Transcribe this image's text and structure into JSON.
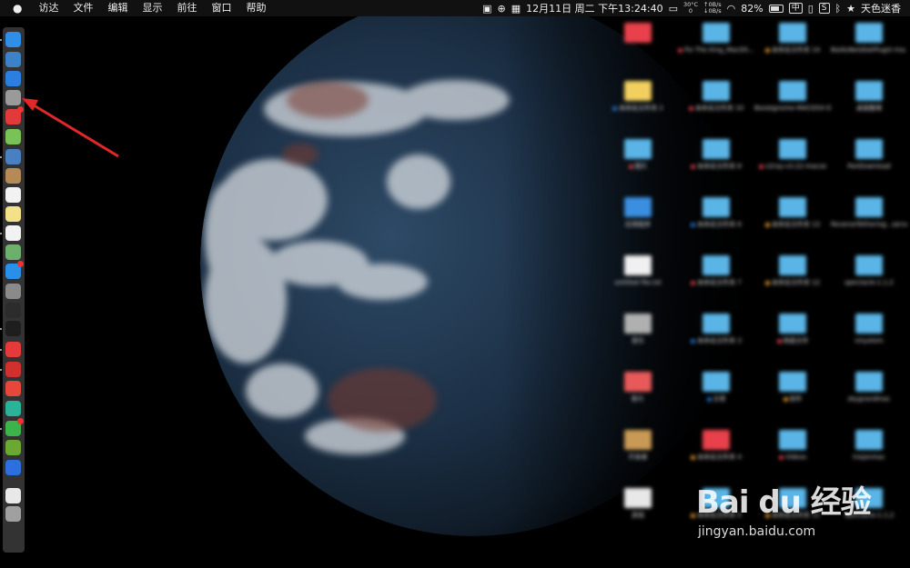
{
  "menubar": {
    "apple_icon": "apple-logo",
    "menus": [
      "访达",
      "文件",
      "编辑",
      "显示",
      "前往",
      "窗口",
      "帮助"
    ],
    "status": {
      "datetime": "12月11日 周二 下午13:24:40",
      "temperature": "30°C",
      "temp_extra": "0",
      "net_up": "0B/s",
      "net_down": "0B/s",
      "battery_percent": "82%",
      "input_method": "中",
      "user_name": "天色迷香",
      "icons": [
        "dropbox-icon",
        "globe-icon",
        "calendar-icon",
        "screen-icon",
        "wifi-icon",
        "battery-icon",
        "ime-icon",
        "s-app-icon",
        "bluetooth-icon",
        "star-icon"
      ]
    }
  },
  "dock": {
    "icons": [
      {
        "name": "finder-icon",
        "color": "#2f8fe8"
      },
      {
        "name": "launchpad-icon",
        "color": "#3b82c8"
      },
      {
        "name": "safari-icon",
        "color": "#2a7fe0"
      },
      {
        "name": "rocket-icon",
        "color": "#9a9a9a"
      },
      {
        "name": "red-app-icon",
        "color": "#e03a3a"
      },
      {
        "name": "android-icon",
        "color": "#78c257"
      },
      {
        "name": "preview-icon",
        "color": "#4a7fc2"
      },
      {
        "name": "notes-brown-icon",
        "color": "#b58a55"
      },
      {
        "name": "calendar-icon",
        "color": "#f2f2f2"
      },
      {
        "name": "notes-icon",
        "color": "#f5e08a"
      },
      {
        "name": "reminders-icon",
        "color": "#f2f2f2"
      },
      {
        "name": "maps-icon",
        "color": "#6bb16b"
      },
      {
        "name": "app-store-icon",
        "color": "#2a8fe8"
      },
      {
        "name": "system-prefs-icon",
        "color": "#8a8a8a"
      },
      {
        "name": "activity-monitor-icon",
        "color": "#2c2c2c"
      },
      {
        "name": "terminal-icon",
        "color": "#1e1e1e"
      },
      {
        "name": "yandex-icon",
        "color": "#e63a3a"
      },
      {
        "name": "vivaldi-icon",
        "color": "#d0312d"
      },
      {
        "name": "weibo-icon",
        "color": "#e6473a"
      },
      {
        "name": "green-app-icon",
        "color": "#2bb39a"
      },
      {
        "name": "wechat-icon",
        "color": "#3bb44a"
      },
      {
        "name": "nvidia-icon",
        "color": "#6aa832"
      },
      {
        "name": "baidu-netdisk-icon",
        "color": "#2d6fe0"
      },
      {
        "name": "document-icon",
        "color": "#e8e8e8"
      },
      {
        "name": "trash-icon",
        "color": "#a0a0a0"
      }
    ]
  },
  "desktop": {
    "files": [
      {
        "label": "",
        "color": "#e8414b",
        "tag": "",
        "col": 0,
        "row": 0
      },
      {
        "label": "Fix The King_MacOS...",
        "color": "#5ab4e6",
        "tag": "#e8414b",
        "col": 1,
        "row": 0
      },
      {
        "label": "未命名文件夹 14",
        "color": "#5ab4e6",
        "tag": "#f0a030",
        "col": 2,
        "row": 0
      },
      {
        "label": "BaiduNetdiskPlugin-ma...master",
        "color": "#5ab4e6",
        "tag": "",
        "col": 3,
        "row": 0
      },
      {
        "label": "未命名文件夹 2",
        "color": "#f2d060",
        "tag": "#2b7fe0",
        "col": 0,
        "row": 1
      },
      {
        "label": "未命名文件夹 10",
        "color": "#5ab4e6",
        "tag": "#e8414b",
        "col": 1,
        "row": 1
      },
      {
        "label": "Boostgnome-MACOSX-GOG",
        "color": "#5ab4e6",
        "tag": "",
        "col": 2,
        "row": 1
      },
      {
        "label": "桌面整理",
        "color": "#5ab4e6",
        "tag": "",
        "col": 3,
        "row": 1
      },
      {
        "label": "图片",
        "color": "#5ab4e6",
        "tag": "#e8414b",
        "col": 0,
        "row": 2
      },
      {
        "label": "未命名文件夹 8",
        "color": "#5ab4e6",
        "tag": "#e8414b",
        "col": 1,
        "row": 2
      },
      {
        "label": "v2ray-v3.22-macos",
        "color": "#5ab4e6",
        "tag": "#e8414b",
        "col": 2,
        "row": 2
      },
      {
        "label": "PanDownload",
        "color": "#5ab4e6",
        "tag": "",
        "col": 3,
        "row": 2
      },
      {
        "label": "应用程序",
        "color": "#3a8fe0",
        "tag": "",
        "col": 0,
        "row": 3
      },
      {
        "label": "未命名文件夹 6",
        "color": "#5ab4e6",
        "tag": "#2b7fe0",
        "col": 1,
        "row": 3
      },
      {
        "label": "未命名文件夹 13",
        "color": "#5ab4e6",
        "tag": "#f0a030",
        "col": 2,
        "row": 3
      },
      {
        "label": "ReverseTethering...server_1.2.0",
        "color": "#5ab4e6",
        "tag": "",
        "col": 3,
        "row": 3
      },
      {
        "label": "untitled file.txt",
        "color": "#f0f0f0",
        "tag": "",
        "col": 0,
        "row": 4
      },
      {
        "label": "未命名文件夹 7",
        "color": "#5ab4e6",
        "tag": "#e8414b",
        "col": 1,
        "row": 4
      },
      {
        "label": "未命名文件夹 12",
        "color": "#5ab4e6",
        "tag": "#f0a030",
        "col": 2,
        "row": 4
      },
      {
        "label": "spectacle-1.1.2",
        "color": "#5ab4e6",
        "tag": "",
        "col": 3,
        "row": 4
      },
      {
        "label": "音乐",
        "color": "#b0b0b0",
        "tag": "",
        "col": 0,
        "row": 5
      },
      {
        "label": "未命名文件夹 3",
        "color": "#5ab4e6",
        "tag": "#2b7fe0",
        "col": 1,
        "row": 5
      },
      {
        "label": "网盘文件",
        "color": "#5ab4e6",
        "tag": "#e8414b",
        "col": 2,
        "row": 5
      },
      {
        "label": "Unystem",
        "color": "#5ab4e6",
        "tag": "",
        "col": 3,
        "row": 5
      },
      {
        "label": "影片",
        "color": "#e85a5a",
        "tag": "",
        "col": 0,
        "row": 6
      },
      {
        "label": "文章",
        "color": "#5ab4e6",
        "tag": "#2b7fe0",
        "col": 1,
        "row": 6
      },
      {
        "label": "软件",
        "color": "#5ab4e6",
        "tag": "#f0a030",
        "col": 2,
        "row": 6
      },
      {
        "label": "skygrandmac",
        "color": "#5ab4e6",
        "tag": "",
        "col": 3,
        "row": 6
      },
      {
        "label": "开发者",
        "color": "#c89a55",
        "tag": "",
        "col": 0,
        "row": 7
      },
      {
        "label": "未命名文件夹 4",
        "color": "#e8414b",
        "tag": "#f0a030",
        "col": 1,
        "row": 7
      },
      {
        "label": "Videos",
        "color": "#5ab4e6",
        "tag": "#e8414b",
        "col": 2,
        "row": 7
      },
      {
        "label": "trojanmac",
        "color": "#5ab4e6",
        "tag": "",
        "col": 3,
        "row": 7
      },
      {
        "label": "其他",
        "color": "#e8e8e8",
        "tag": "",
        "col": 0,
        "row": 8
      },
      {
        "label": "未命名文件夹 5",
        "color": "#5ab4e6",
        "tag": "#f0a030",
        "col": 1,
        "row": 8
      },
      {
        "label": "未命名文件夹 11",
        "color": "#5ab4e6",
        "tag": "#f0a030",
        "col": 2,
        "row": 8
      },
      {
        "label": "Spectacle-1.1.2",
        "color": "#5ab4e6",
        "tag": "",
        "col": 3,
        "row": 8
      }
    ]
  },
  "watermark": {
    "logo_text": "Bai du 经验",
    "url": "jingyan.baidu.com"
  }
}
